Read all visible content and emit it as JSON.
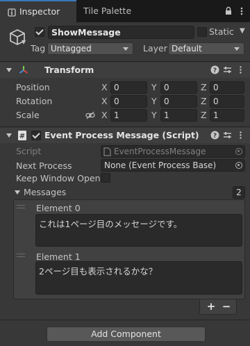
{
  "tabs": {
    "inspector": "Inspector",
    "tile_palette": "Tile Palette"
  },
  "gameobject": {
    "active": true,
    "name": "ShowMessage",
    "static_label": "Static",
    "static_checked": false,
    "tag_label": "Tag",
    "tag_value": "Untagged",
    "layer_label": "Layer",
    "layer_value": "Default"
  },
  "transform": {
    "title": "Transform",
    "rows": [
      {
        "label": "Position",
        "x": "0",
        "y": "0",
        "z": "0"
      },
      {
        "label": "Rotation",
        "x": "0",
        "y": "0",
        "z": "0"
      },
      {
        "label": "Scale",
        "x": "1",
        "y": "1",
        "z": "1"
      }
    ],
    "axis_x": "X",
    "axis_y": "Y",
    "axis_z": "Z"
  },
  "script_component": {
    "title": "Event Process Message (Script)",
    "enabled": true,
    "script_label": "Script",
    "script_value": "EventProcessMessage",
    "next_process_label": "Next Process",
    "next_process_value": "None (Event Process Base)",
    "keep_window_label": "Keep Window Open",
    "keep_window_checked": false,
    "messages_label": "Messages",
    "messages_count": "2",
    "elements": [
      {
        "label": "Element 0",
        "text": "これは1ページ目のメッセージです。"
      },
      {
        "label": "Element 1",
        "text": "2ページ目も表示されるかな？"
      }
    ],
    "plus": "+",
    "minus": "−"
  },
  "add_component": "Add Component",
  "icons": [
    "inspector-icon",
    "lock-icon",
    "more-icon",
    "cube-icon",
    "transform-icon",
    "help-icon",
    "presets-icon",
    "script-file-icon",
    "object-picker-icon",
    "link-icon"
  ]
}
